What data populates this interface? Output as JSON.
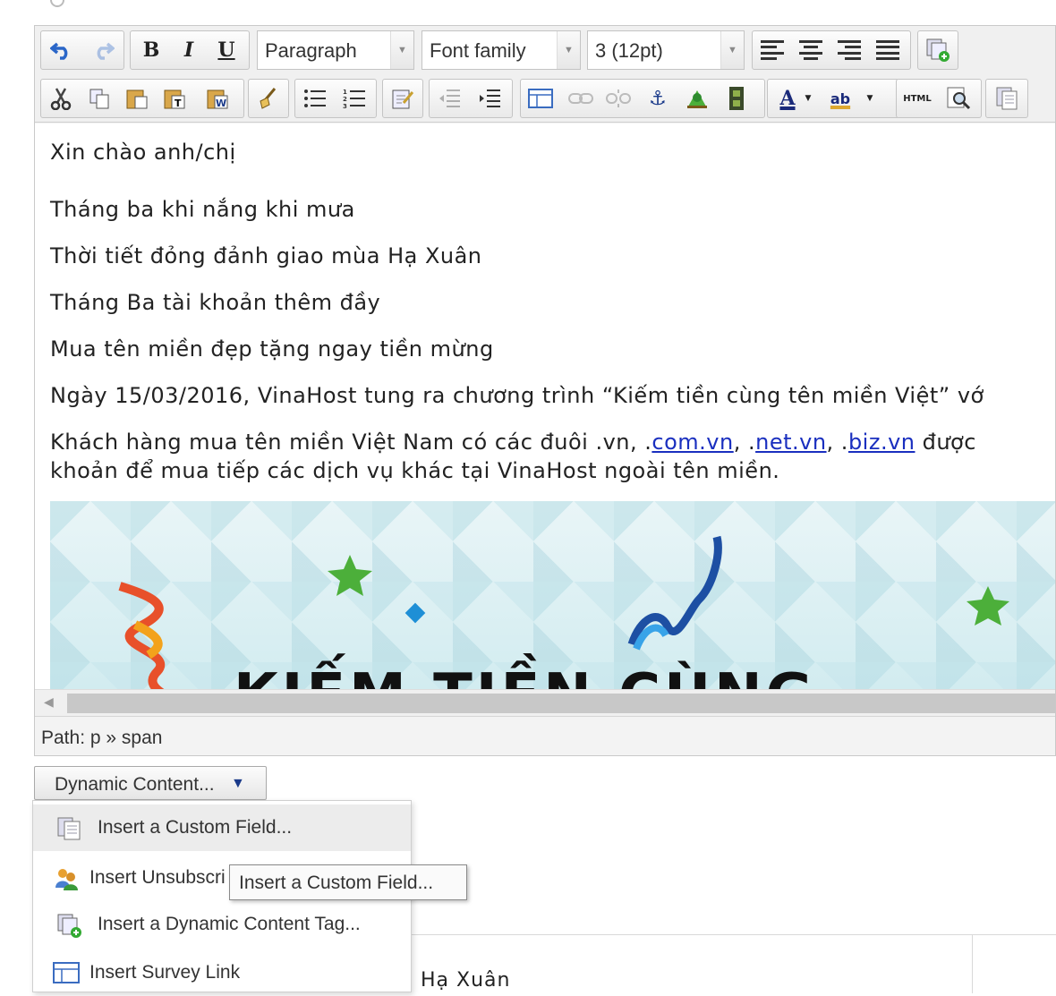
{
  "toolbar": {
    "row1": {
      "undo_icon": "undo-icon",
      "redo_icon": "redo-icon",
      "bold_label": "B",
      "italic_label": "I",
      "underline_label": "U",
      "format_select": "Paragraph",
      "font_family_select": "Font family",
      "font_size_select": "3 (12pt)",
      "align_icons": [
        "align-left-icon",
        "align-center-icon",
        "align-right-icon",
        "align-justify-icon"
      ],
      "paste_icon": "template-icon"
    },
    "row2": {
      "icons": [
        "cut-icon",
        "copy-icon",
        "paste-icon",
        "paste-text-icon",
        "paste-word-icon",
        "cleanup-icon",
        "bullet-list-icon",
        "numbered-list-icon",
        "edit-icon",
        "outdent-icon",
        "indent-icon",
        "table-icon",
        "link-icon",
        "unlink-icon",
        "anchor-icon",
        "image-icon",
        "media-icon",
        "text-color-icon",
        "highlight-color-icon",
        "html-source-icon",
        "preview-icon",
        "custom-field-icon"
      ],
      "html_label": "HTML",
      "text_color_label": "A",
      "highlight_label": "ab"
    }
  },
  "content": {
    "greeting": "Xin chào anh/chị",
    "line1": "Tháng ba khi nắng khi mưa",
    "line2": "Thời tiết đỏng đảnh giao mùa Hạ Xuân",
    "line3": "Tháng Ba tài khoản thêm đầy",
    "line4": "Mua tên miền đẹp tặng ngay tiền mừng",
    "line5": "Ngày 15/03/2016, VinaHost tung ra chương trình “Kiếm tiền cùng tên miền Việt” vớ",
    "line6_pre": "Khách hàng mua tên miền Việt Nam có các đuôi .vn, .",
    "link1": "com.vn",
    "sep1": ", .",
    "link2": "net.vn",
    "sep2": ", .",
    "link3": "biz.vn",
    "line6_post": " được",
    "line7": "khoản để mua tiếp các dịch vụ khác tại VinaHost ngoài tên miền.",
    "banner_text": "KIẾM TIỀN CÙNG"
  },
  "path_bar": {
    "label": "Path: p » span"
  },
  "dynamic_content": {
    "button_label": "Dynamic Content...",
    "items": [
      {
        "label": "Insert a Custom Field...",
        "icon": "custom-field-icon"
      },
      {
        "label": "Insert Unsubscri",
        "icon": "unsubscribe-users-icon"
      },
      {
        "label": "Insert a Dynamic Content Tag...",
        "icon": "dynamic-tag-icon"
      },
      {
        "label": "Insert Survey Link",
        "icon": "survey-link-icon"
      }
    ]
  },
  "tooltip": {
    "text": "Insert a Custom Field..."
  },
  "background_text": "Hạ Xuân",
  "colors": {
    "link": "#1a2fbf",
    "star": "#4caf3a",
    "ribbon_blue": "#1d4fa3"
  }
}
